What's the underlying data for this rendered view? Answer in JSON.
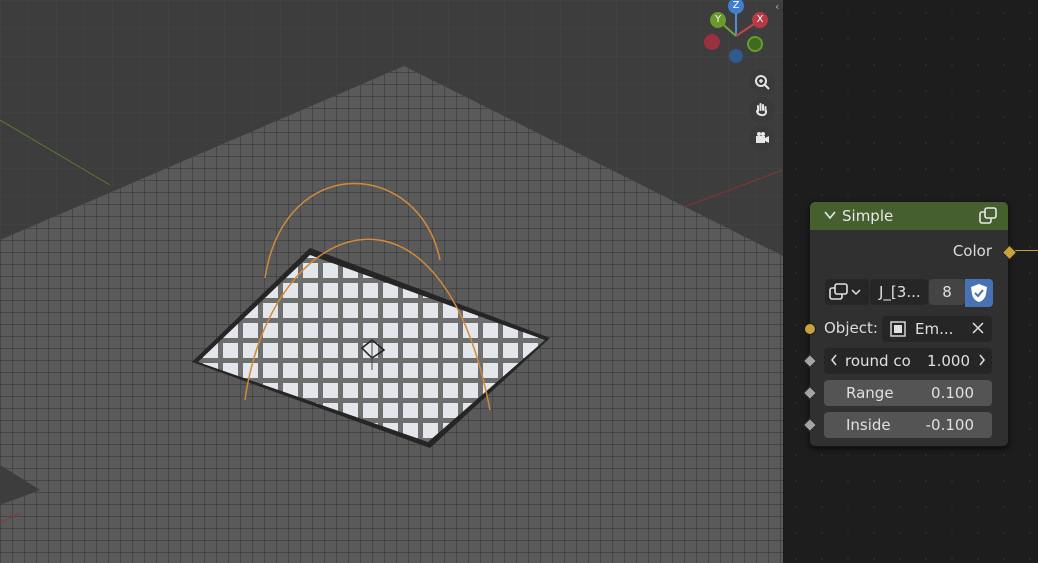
{
  "viewport": {
    "gizmo": {
      "z_label": "Z",
      "y_label": "Y",
      "x_label": "X"
    },
    "nav_icons": [
      "zoom-icon",
      "hand-pan-icon",
      "camera-icon"
    ]
  },
  "node": {
    "title": "Simple",
    "header_color": "#45602e",
    "output_label": "Color",
    "image_name": "J_[3...",
    "user_count": "8",
    "object_label": "Object:",
    "object_value": "Em...",
    "round_label": "round co",
    "round_value": "1.000",
    "range_label": "Range",
    "range_value": "0.100",
    "inside_label": "Inside",
    "inside_value": "-0.100"
  }
}
